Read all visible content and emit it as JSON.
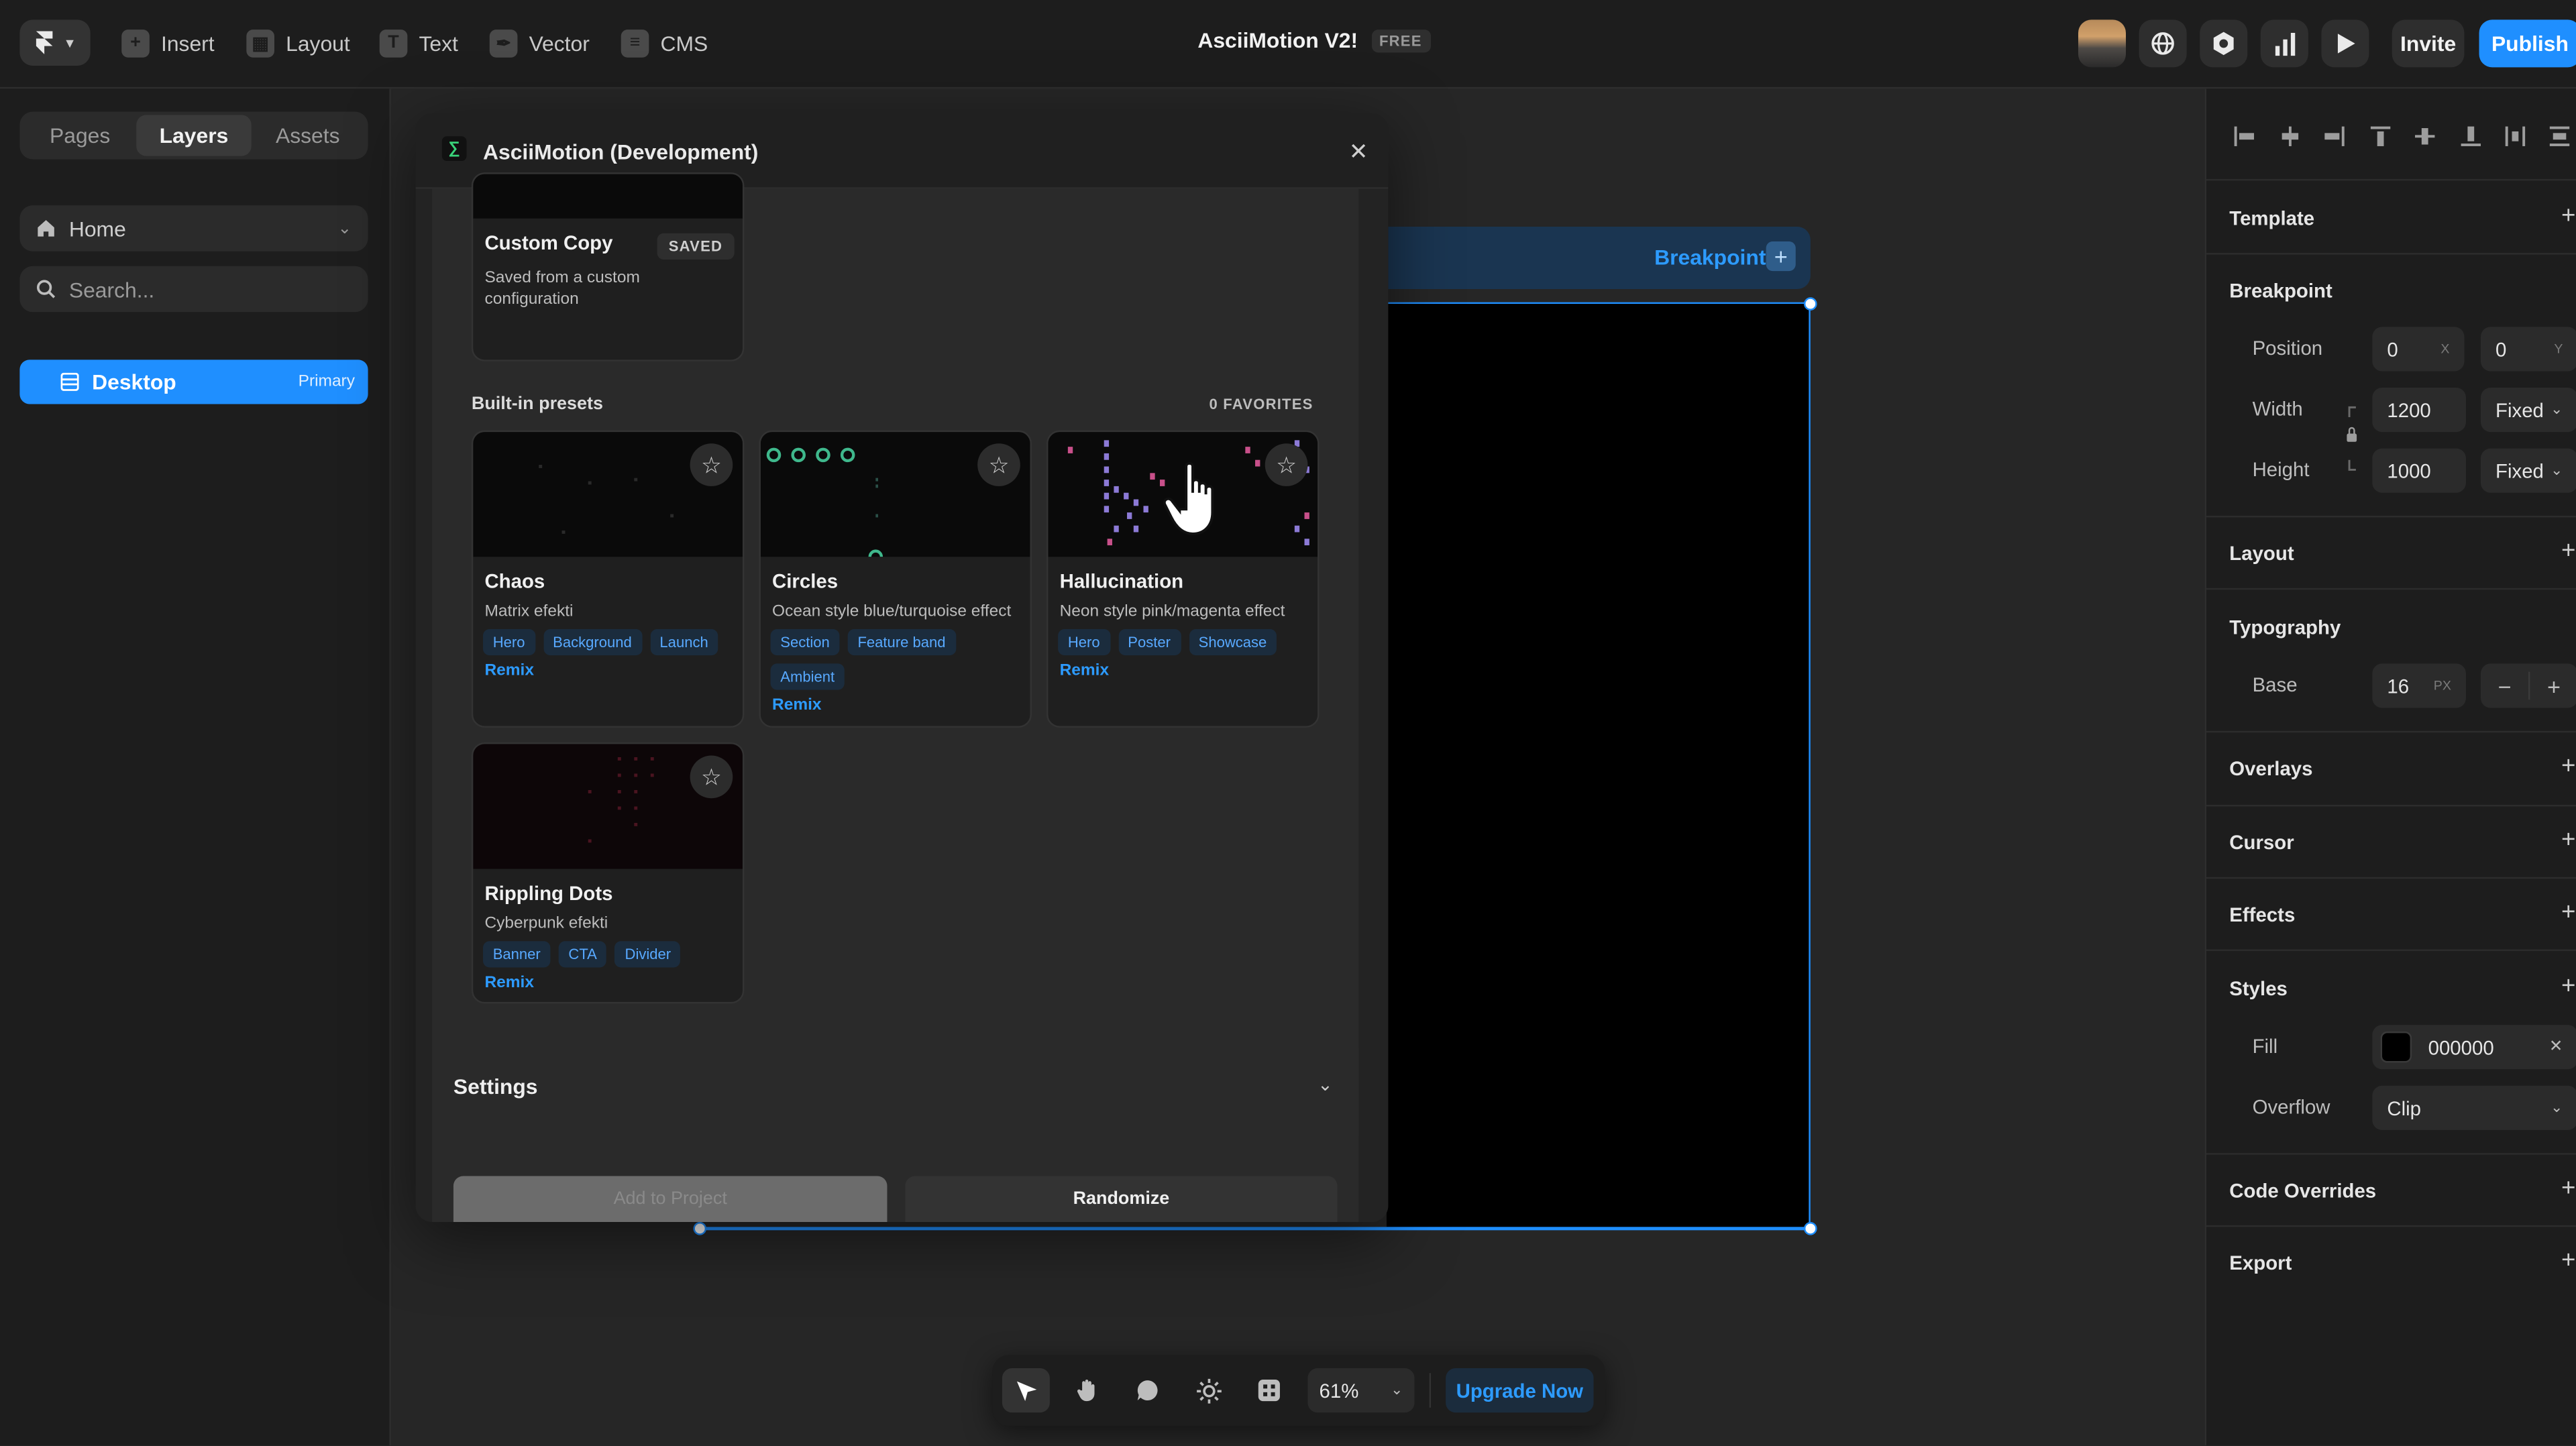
{
  "topbar": {
    "tools": [
      {
        "label": "Insert",
        "icon": "plus-square-icon"
      },
      {
        "label": "Layout",
        "icon": "layout-icon"
      },
      {
        "label": "Text",
        "icon": "text-icon"
      },
      {
        "label": "Vector",
        "icon": "pen-icon"
      },
      {
        "label": "CMS",
        "icon": "database-icon"
      }
    ],
    "project_title": "AsciiMotion V2!",
    "plan_badge": "FREE",
    "invite_label": "Invite",
    "publish_label": "Publish"
  },
  "left_panel": {
    "tabs": [
      "Pages",
      "Layers",
      "Assets"
    ],
    "active_tab": "Layers",
    "page_selector": "Home",
    "search_placeholder": "Search...",
    "layers": [
      {
        "name": "Desktop",
        "badge": "Primary"
      }
    ]
  },
  "canvas": {
    "breakpoint_label": "Breakpoint"
  },
  "plugin": {
    "title": "AsciiMotion (Development)",
    "saved_card": {
      "title": "Custom Copy",
      "badge": "SAVED",
      "desc": "Saved from a custom configuration"
    },
    "builtin_heading": "Built-in presets",
    "favorites_count": "0 FAVORITES",
    "presets": [
      {
        "title": "Chaos",
        "desc": "Matrix efekti",
        "tags": [
          "Hero",
          "Background",
          "Launch"
        ],
        "action": "Remix"
      },
      {
        "title": "Circles",
        "desc": "Ocean style blue/turquoise effect",
        "tags": [
          "Section",
          "Feature band",
          "Ambient"
        ],
        "action": "Remix"
      },
      {
        "title": "Hallucination",
        "desc": "Neon style pink/magenta effect",
        "tags": [
          "Hero",
          "Poster",
          "Showcase"
        ],
        "action": "Remix"
      },
      {
        "title": "Rippling Dots",
        "desc": "Cyberpunk efekti",
        "tags": [
          "Banner",
          "CTA",
          "Divider"
        ],
        "action": "Remix"
      }
    ],
    "settings_label": "Settings",
    "add_button": "Add to Project",
    "randomize_button": "Randomize"
  },
  "right_panel": {
    "sections": {
      "template": "Template",
      "breakpoint": "Breakpoint",
      "layout": "Layout",
      "typography": "Typography",
      "overlays": "Overlays",
      "cursor": "Cursor",
      "effects": "Effects",
      "styles": "Styles",
      "code_overrides": "Code Overrides",
      "export": "Export"
    },
    "position": {
      "label": "Position",
      "x": "0",
      "x_unit": "X",
      "y": "0",
      "y_unit": "Y"
    },
    "width": {
      "label": "Width",
      "value": "1200",
      "mode": "Fixed"
    },
    "height": {
      "label": "Height",
      "value": "1000",
      "mode": "Fixed"
    },
    "base": {
      "label": "Base",
      "value": "16",
      "unit": "PX"
    },
    "fill": {
      "label": "Fill",
      "value": "000000",
      "color": "#000000"
    },
    "overflow": {
      "label": "Overflow",
      "value": "Clip"
    }
  },
  "bottom_toolbar": {
    "zoom": "61%",
    "upgrade_label": "Upgrade Now"
  },
  "colors": {
    "accent": "#1f8fff",
    "link": "#2d9bff",
    "panel": "#1d1d1d",
    "canvas": "#262626"
  }
}
